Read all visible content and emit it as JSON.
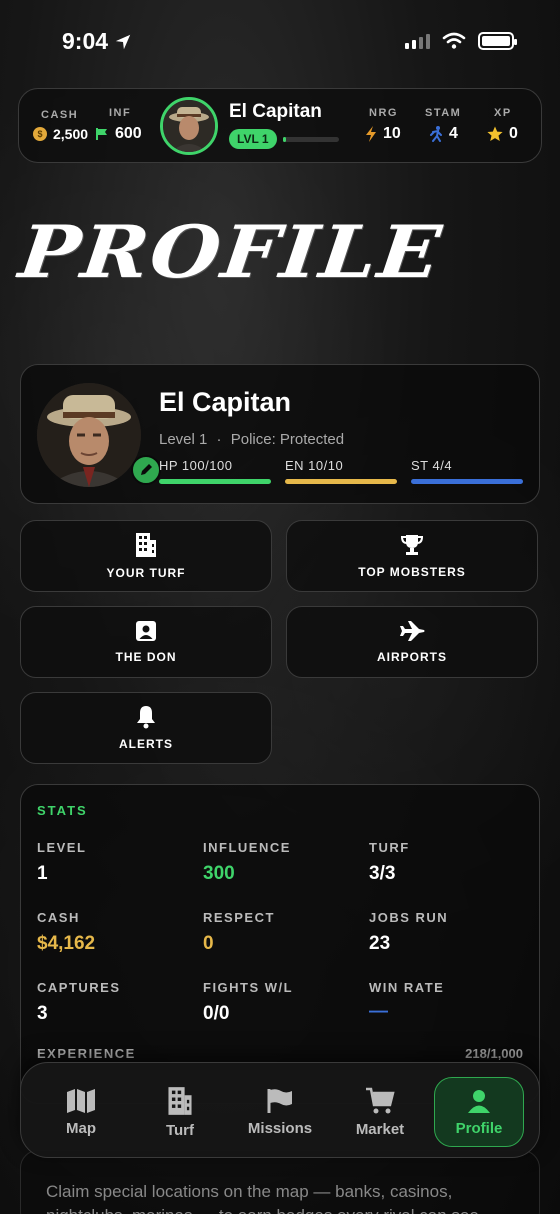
{
  "status_bar": {
    "time": "9:04"
  },
  "hud": {
    "cash_label": "CASH",
    "cash_value": "2,500",
    "inf_label": "INF",
    "inf_value": "600",
    "player_name": "El Capitan",
    "level_pill": "LVL 1",
    "xp_progress": 0.05,
    "nrg_label": "NRG",
    "nrg_value": "10",
    "stam_label": "STAM",
    "stam_value": "4",
    "xp_label": "XP",
    "xp_value": "0"
  },
  "page_title": "Profile",
  "profile": {
    "name": "El Capitan",
    "level_text": "Level 1",
    "police_text": "Police: Protected",
    "hp_label": "HP 100/100",
    "en_label": "EN 10/10",
    "st_label": "ST 4/4",
    "colors": {
      "hp": "#3fd46a",
      "en": "#e6b84a",
      "st": "#3a6fd8"
    }
  },
  "menu": {
    "your_turf": "YOUR TURF",
    "top_mobsters": "TOP MOBSTERS",
    "the_don": "THE DON",
    "airports": "AIRPORTS",
    "alerts": "ALERTS"
  },
  "stats": {
    "heading": "STATS",
    "level_label": "LEVEL",
    "level_value": "1",
    "influence_label": "INFLUENCE",
    "influence_value": "300",
    "turf_label": "TURF",
    "turf_value": "3/3",
    "cash_label": "CASH",
    "cash_value": "$4,162",
    "respect_label": "RESPECT",
    "respect_value": "0",
    "jobs_label": "JOBS RUN",
    "jobs_value": "23",
    "captures_label": "CAPTURES",
    "captures_value": "3",
    "fights_label": "FIGHTS W/L",
    "fights_value": "0/0",
    "winrate_label": "WIN RATE",
    "winrate_value": "—",
    "experience_label": "EXPERIENCE",
    "experience_value": "218/1,000"
  },
  "nav": {
    "map": "Map",
    "turf": "Turf",
    "missions": "Missions",
    "market": "Market",
    "profile": "Profile"
  },
  "footer_text": "Claim special locations on the map — banks, casinos, nightclubs, marinas — to earn badges every rival can see."
}
